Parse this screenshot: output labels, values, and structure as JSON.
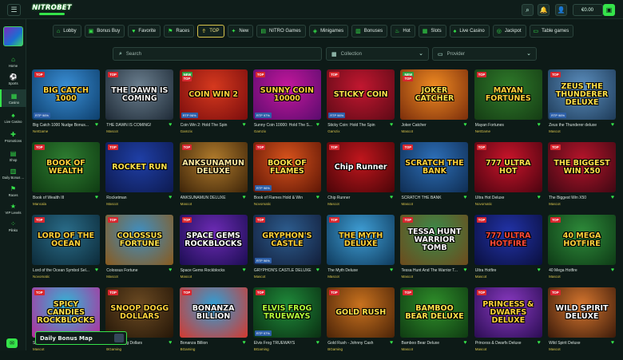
{
  "header": {
    "menu_icon": "hamburger-icon",
    "logo_text": "NITROBET",
    "balance": "€0.00",
    "icons": [
      "search-icon",
      "bell-icon",
      "user-icon",
      "wallet-icon"
    ]
  },
  "sidebar": {
    "items": [
      {
        "label": "Home",
        "icon": "home-icon"
      },
      {
        "label": "Sports",
        "icon": "ball-icon"
      },
      {
        "label": "Casino",
        "icon": "slot-icon"
      },
      {
        "label": "Live Casino",
        "icon": "cards-icon"
      },
      {
        "label": "Promotions",
        "icon": "gift-icon"
      },
      {
        "label": "Shop",
        "icon": "cart-icon"
      },
      {
        "label": "Daily Bonus ...",
        "icon": "calendar-icon"
      },
      {
        "label": "Races",
        "icon": "flag-icon"
      },
      {
        "label": "VIP Levels",
        "icon": "star-icon"
      },
      {
        "label": "Plinko",
        "icon": "plinko-icon"
      }
    ]
  },
  "categories": [
    {
      "label": "Lobby",
      "icon": "lobby-icon",
      "active": false
    },
    {
      "label": "Bonus Buy",
      "icon": "bonus-buy-icon",
      "active": false
    },
    {
      "label": "Favorite",
      "icon": "heart-icon",
      "active": false
    },
    {
      "label": "Races",
      "icon": "race-icon",
      "active": false
    },
    {
      "label": "TOP",
      "icon": "top-icon",
      "active": true
    },
    {
      "label": "New",
      "icon": "new-icon",
      "active": false
    },
    {
      "label": "NITRO Games",
      "icon": "nitro-icon",
      "active": false
    },
    {
      "label": "Minigames",
      "icon": "minigames-icon",
      "active": false
    },
    {
      "label": "Bonuses",
      "icon": "bonuses-icon",
      "active": false
    },
    {
      "label": "Hot",
      "icon": "fire-icon",
      "active": false
    },
    {
      "label": "Slots",
      "icon": "slots-icon",
      "active": false
    },
    {
      "label": "Live Casino",
      "icon": "live-casino-icon",
      "active": false
    },
    {
      "label": "Jackpot",
      "icon": "jackpot-icon",
      "active": false
    },
    {
      "label": "Table games",
      "icon": "table-games-icon",
      "active": false
    }
  ],
  "filters": {
    "search_placeholder": "Search",
    "collection_placeholder": "Collection",
    "provider_placeholder": "Provider"
  },
  "games": [
    {
      "name": "Big Catch 1000 Nudge Bonus...",
      "provider": "NetGame",
      "art": "BIG CATCH 1000",
      "badges": [
        "TOP"
      ],
      "rtp": "RTP 96%",
      "colors": [
        "#3a8fd6",
        "#0d3e6b"
      ],
      "art_color": "#ffd23a"
    },
    {
      "name": "THE DAWN IS COMING!",
      "provider": "Mascot",
      "art": "THE DAWN IS COMING",
      "badges": [
        "TOP"
      ],
      "rtp": "",
      "colors": [
        "#6b7f8f",
        "#1e2a36"
      ],
      "art_color": "#f2f2f2"
    },
    {
      "name": "Coin Win 2: Hold The Spin",
      "provider": "Gamzix",
      "art": "COIN WIN 2",
      "badges": [
        "NEW",
        "TOP"
      ],
      "rtp": "RTP 96%",
      "colors": [
        "#d6391e",
        "#7a0d0d"
      ],
      "art_color": "#ffd23a"
    },
    {
      "name": "Sunny Coin 10000: Hold The S...",
      "provider": "Gamzix",
      "art": "SUNNY COIN 10000",
      "badges": [
        "TOP"
      ],
      "rtp": "RTP 97%",
      "colors": [
        "#c4179c",
        "#5a0c6e"
      ],
      "art_color": "#ffd23a"
    },
    {
      "name": "Sticky Coin: Hold The Spin",
      "provider": "Gamzix",
      "art": "STICKY COIN",
      "badges": [
        "TOP"
      ],
      "rtp": "RTP 96%",
      "colors": [
        "#c21730",
        "#5d0a16"
      ],
      "art_color": "#ffe14a"
    },
    {
      "name": "Joker Catcher",
      "provider": "Mascot",
      "art": "JOKER CATCHER",
      "badges": [
        "NEW",
        "TOP"
      ],
      "rtp": "",
      "colors": [
        "#f08b22",
        "#7a2d0b"
      ],
      "art_color": "#ffe14a"
    },
    {
      "name": "Mayan Fortunes",
      "provider": "NetGame",
      "art": "MAYAN FORTUNES",
      "badges": [
        "TOP"
      ],
      "rtp": "",
      "colors": [
        "#2f7a2a",
        "#153c14"
      ],
      "art_color": "#ffd23a"
    },
    {
      "name": "Zeus the Thunderer deluxe",
      "provider": "Mascot",
      "art": "ZEUS THE THUNDERER DELUXE",
      "badges": [
        "TOP"
      ],
      "rtp": "RTP 96%",
      "colors": [
        "#5c8fbf",
        "#1d3a57"
      ],
      "art_color": "#ffe14a"
    },
    {
      "name": "Book of Wealth III",
      "provider": "Mancala",
      "art": "BOOK OF WEALTH",
      "badges": [
        "TOP"
      ],
      "rtp": "",
      "colors": [
        "#2e7d31",
        "#0f3b12"
      ],
      "art_color": "#ffd23a"
    },
    {
      "name": "Rocketman",
      "provider": "Mascot",
      "art": "ROCKET RUN",
      "badges": [
        "TOP"
      ],
      "rtp": "",
      "colors": [
        "#1f3fa6",
        "#0d1a4f"
      ],
      "art_color": "#ffe14a"
    },
    {
      "name": "ANKSUNAMUN DELUXE",
      "provider": "Mascot",
      "art": "ANKSUNAMUN DELUXE",
      "badges": [
        "TOP"
      ],
      "rtp": "",
      "colors": [
        "#b07b2c",
        "#3d2409"
      ],
      "art_color": "#ffe9a0"
    },
    {
      "name": "Book of Flames Hold & Win",
      "provider": "Novomatic",
      "art": "BOOK OF FLAMES",
      "badges": [
        "TOP"
      ],
      "rtp": "RTP 96%",
      "colors": [
        "#d8531c",
        "#5e1606"
      ],
      "art_color": "#ffe14a"
    },
    {
      "name": "Chip Runner",
      "provider": "Mascot",
      "art": "Chip Runner",
      "badges": [
        "TOP"
      ],
      "rtp": "",
      "colors": [
        "#c0161d",
        "#4a0508"
      ],
      "art_color": "#ffffff"
    },
    {
      "name": "SCRATCH THE BANK",
      "provider": "Mascot",
      "art": "SCRATCH THE BANK",
      "badges": [
        "TOP"
      ],
      "rtp": "",
      "colors": [
        "#2d6fb8",
        "#0f2d52"
      ],
      "art_color": "#ffd23a"
    },
    {
      "name": "Ultra Hot Deluxe",
      "provider": "Novomatic",
      "art": "777 ULTRA HOT",
      "badges": [
        "TOP"
      ],
      "rtp": "",
      "colors": [
        "#c9142a",
        "#4a0410"
      ],
      "art_color": "#ffe14a"
    },
    {
      "name": "The Biggest Win X50",
      "provider": "Mascot",
      "art": "THE BIGGEST WIN X50",
      "badges": [
        "TOP"
      ],
      "rtp": "",
      "colors": [
        "#b5142a",
        "#3e0813"
      ],
      "art_color": "#ffe14a"
    },
    {
      "name": "Lord of the Ocean Symbol Sel...",
      "provider": "Novomatic",
      "art": "LORD OF THE OCEAN",
      "badges": [
        "TOP"
      ],
      "rtp": "",
      "colors": [
        "#2a6d8a",
        "#0c2a38"
      ],
      "art_color": "#ffd23a"
    },
    {
      "name": "Colossus Fortune",
      "provider": "Mascot",
      "art": "COLOSSUS FORTUNE",
      "badges": [
        "TOP"
      ],
      "rtp": "",
      "colors": [
        "#3f8fc2",
        "#8a5a1c"
      ],
      "art_color": "#ffe14a"
    },
    {
      "name": "Space Gems Rockblocks",
      "provider": "Mascot",
      "art": "SPACE GEMS ROCKBLOCKS",
      "badges": [
        "TOP"
      ],
      "rtp": "",
      "colors": [
        "#6d2bb5",
        "#1b0d52"
      ],
      "art_color": "#ffffff"
    },
    {
      "name": "GRYPHON'S CASTLE DELUXE",
      "provider": "Mascot",
      "art": "GRYPHON'S CASTLE",
      "badges": [
        "TOP"
      ],
      "rtp": "RTP 96%",
      "colors": [
        "#2d5d8f",
        "#121e3a"
      ],
      "art_color": "#ffd23a"
    },
    {
      "name": "The Myth Deluxe",
      "provider": "Mascot",
      "art": "THE MYTH DELUXE",
      "badges": [
        "TOP"
      ],
      "rtp": "",
      "colors": [
        "#3f9fd6",
        "#0f3a5c"
      ],
      "art_color": "#ffd23a"
    },
    {
      "name": "Tessa Hunt And The Warrior T...",
      "provider": "Mascot",
      "art": "TESSA HUNT WARRIOR TOMB",
      "badges": [
        "TOP"
      ],
      "rtp": "",
      "colors": [
        "#3a8b4a",
        "#6e4a1c"
      ],
      "art_color": "#ffffff"
    },
    {
      "name": "Ultra Hotfire",
      "provider": "Mascot",
      "art": "777 ULTRA HOTFIRE",
      "badges": [
        "TOP"
      ],
      "rtp": "",
      "colors": [
        "#2233a8",
        "#0a0f3e"
      ],
      "art_color": "#ff4a3a"
    },
    {
      "name": "40 Mega Hotfire",
      "provider": "Mascot",
      "art": "40 MEGA HOTFIRE",
      "badges": [
        "TOP"
      ],
      "rtp": "",
      "colors": [
        "#2e8b3a",
        "#0e3a16"
      ],
      "art_color": "#ffd23a"
    },
    {
      "name": "Spicy Candies Rockblocks",
      "provider": "Mascot",
      "art": "SPICY CANDIES ROCKBLOCKS",
      "badges": [
        "TOP"
      ],
      "rtp": "",
      "colors": [
        "#2fb8d6",
        "#b82a9b"
      ],
      "art_color": "#ffe14a"
    },
    {
      "name": "Snoop Dogg Dollars",
      "provider": "BGaming",
      "art": "SNOOP DOGG DOLLARS",
      "badges": [
        "TOP"
      ],
      "rtp": "",
      "colors": [
        "#6b4a22",
        "#241608"
      ],
      "art_color": "#ffd23a"
    },
    {
      "name": "Bonanza Billion",
      "provider": "BGaming",
      "art": "BONANZA BILLION",
      "badges": [
        "TOP"
      ],
      "rtp": "",
      "colors": [
        "#2e9fd6",
        "#d6382e"
      ],
      "art_color": "#ffffff"
    },
    {
      "name": "Elvis Frog TRUEWAYS",
      "provider": "BGaming",
      "art": "ELVIS FROG TRUEWAYS",
      "badges": [
        "TOP"
      ],
      "rtp": "RTP 97%",
      "colors": [
        "#1f8a3a",
        "#0a2e12"
      ],
      "art_color": "#b6ff3a"
    },
    {
      "name": "Gold Rush - Johnny Cash",
      "provider": "BGaming",
      "art": "GOLD RUSH",
      "badges": [
        "TOP"
      ],
      "rtp": "",
      "colors": [
        "#c9721e",
        "#4a2308"
      ],
      "art_color": "#ffe14a"
    },
    {
      "name": "Bamboo Bear Deluxe",
      "provider": "Mascot",
      "art": "BAMBOO BEAR DELUXE",
      "badges": [
        "TOP"
      ],
      "rtp": "",
      "colors": [
        "#2f8f2a",
        "#0f3a12"
      ],
      "art_color": "#ffe14a"
    },
    {
      "name": "Princess & Dwarfs Deluxe",
      "provider": "Mascot",
      "art": "PRINCESS & DWARFS DELUXE",
      "badges": [
        "TOP"
      ],
      "rtp": "",
      "colors": [
        "#8a3ac2",
        "#2a0d52"
      ],
      "art_color": "#ffd23a"
    },
    {
      "name": "Wild Spirit Deluxe",
      "provider": "Mascot",
      "art": "WILD SPIRIT DELUXE",
      "badges": [
        "TOP"
      ],
      "rtp": "",
      "colors": [
        "#d6762e",
        "#3a1a0a"
      ],
      "art_color": "#ffffff"
    }
  ],
  "bonus_map": {
    "label": "Daily Bonus Map"
  }
}
